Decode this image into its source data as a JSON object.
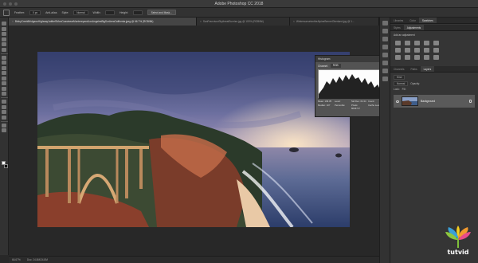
{
  "app": {
    "title": "Adobe Photoshop CC 2018"
  },
  "options": {
    "feather": "Feather:",
    "feather_value": "0 px",
    "antialias": "Anti-alias",
    "style_label": "Style:",
    "style_value": "Normal",
    "width_label": "Width:",
    "height_label": "Height:",
    "select_mask": "Select and Mask..."
  },
  "tabs": [
    {
      "label": "BixbyCreekBridgeonHighway1attheSMonCoastnearMontereyandLosAngelesBigSurAreaCalifornia.jpeg @ 66.7% (RGB/8#)"
    },
    {
      "label": "SanFranciscoSkylineatSunrise.jpg @ 100% (RGB/8#)"
    },
    {
      "label": "WintersunsetontheAlpineBernerOberland.jpg @ 1..."
    }
  ],
  "histogram": {
    "title": "Histogram",
    "channel_label": "Channel:",
    "channel_value": "RGB",
    "stats": [
      "Mean: 109.35",
      "Level:",
      "Std Dev: 64.34",
      "Count:",
      "Median: 107",
      "Percentile:",
      "Pixels: 8646717",
      "Cache Level: 1"
    ]
  },
  "status": {
    "zoom": "66.67%",
    "doc": "Doc: 24.8M/24.8M"
  },
  "panels": {
    "top_tabs": [
      "Libraries",
      "Color",
      "Swatches"
    ],
    "mid_tabs": [
      "Styles",
      "Adjustments"
    ],
    "add_adjustment": "Add an adjustment",
    "layer_tabs": [
      "Channels",
      "Paths",
      "Layers"
    ],
    "kind_label": "Kind",
    "blend_mode": "Normal",
    "opacity_label": "Opacity:",
    "lock_label": "Lock:",
    "fill_label": "Fill:",
    "layer_name": "Background"
  },
  "watermark": {
    "brand": "tutvid"
  }
}
